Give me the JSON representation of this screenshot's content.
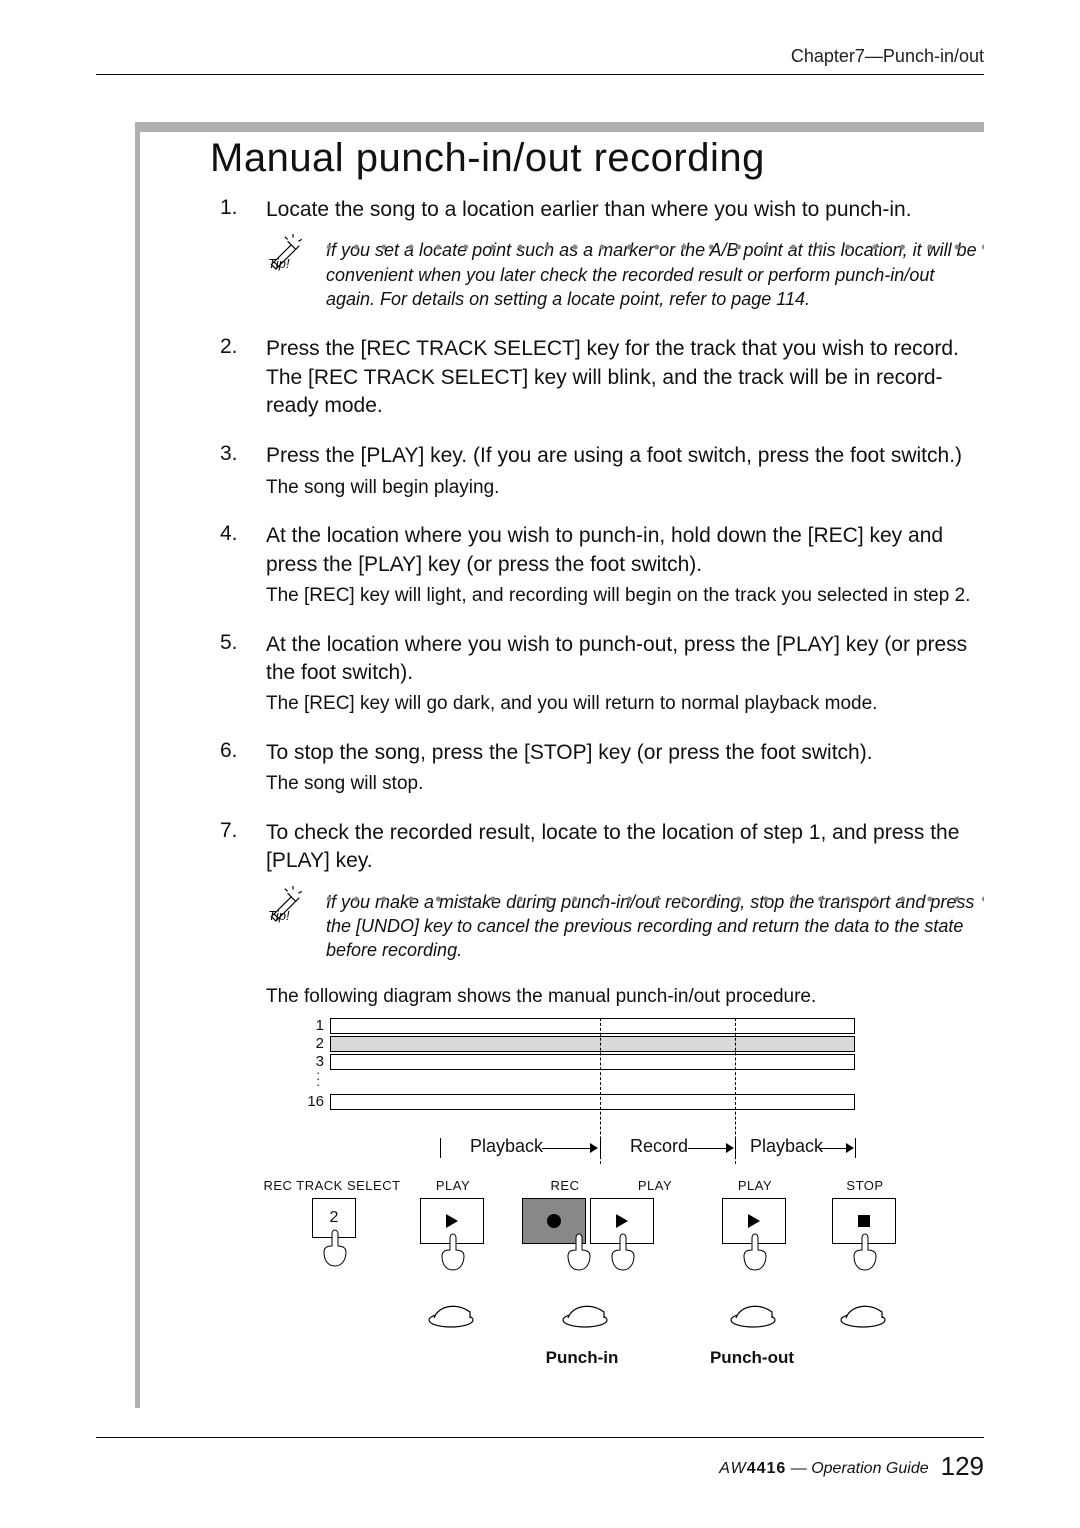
{
  "running_head": "Chapter7—Punch-in/out",
  "heading": "Manual punch-in/out recording",
  "steps": [
    {
      "num": "1.",
      "bold": "Locate the song to a location earlier than where you wish to punch-in.",
      "sub": "",
      "tip": "If you set a locate point such as a marker or the A/B point at this location, it will be convenient when you later check the recorded result or perform punch-in/out again. For details on setting a locate point, refer to page 114.",
      "tip_label": "Tip!"
    },
    {
      "num": "2.",
      "bold": "Press the [REC TRACK SELECT] key for the track that you wish to record. The [REC TRACK SELECT] key will blink, and the track will be in record-ready mode.",
      "sub": ""
    },
    {
      "num": "3.",
      "bold": "Press the [PLAY] key. (If you are using a foot switch, press the foot switch.)",
      "sub": "The song will begin playing."
    },
    {
      "num": "4.",
      "bold": "At the location where you wish to punch-in, hold down the [REC] key and press the [PLAY] key (or press the foot switch).",
      "sub": "The [REC] key will light, and recording will begin on the track you selected in step 2."
    },
    {
      "num": "5.",
      "bold": "At the location where you wish to punch-out, press the [PLAY] key (or press the foot switch).",
      "sub": "The [REC] key will go dark, and you will return to normal playback mode."
    },
    {
      "num": "6.",
      "bold": "To stop the song, press the [STOP] key (or press the foot switch).",
      "sub": "The song will stop."
    },
    {
      "num": "7.",
      "bold": "To check the recorded result, locate to the location of step 1, and press the [PLAY] key.",
      "sub": "",
      "tip": "If you make a mistake during punch-in/out recording, stop the transport and press the [UNDO] key to cancel the previous recording and return the data to the state before recording.",
      "tip_label": "Tip!"
    }
  ],
  "diagram_caption": "The following diagram shows the manual punch-in/out procedure.",
  "diagram": {
    "track_labels": {
      "t1": "1",
      "t2": "2",
      "t3": "3",
      "t16": "16"
    },
    "phase_playback": "Playback",
    "phase_record": "Record",
    "phase_playback2": "Playback",
    "rec_track_select": "REC TRACK SELECT",
    "captions": {
      "play": "PLAY",
      "rec": "REC",
      "stop": "STOP"
    },
    "btn2": "2",
    "punch_in": "Punch-in",
    "punch_out": "Punch-out"
  },
  "footer": {
    "logo": "AW",
    "model": "4416",
    "opguide": " — Operation Guide",
    "page": "129"
  }
}
